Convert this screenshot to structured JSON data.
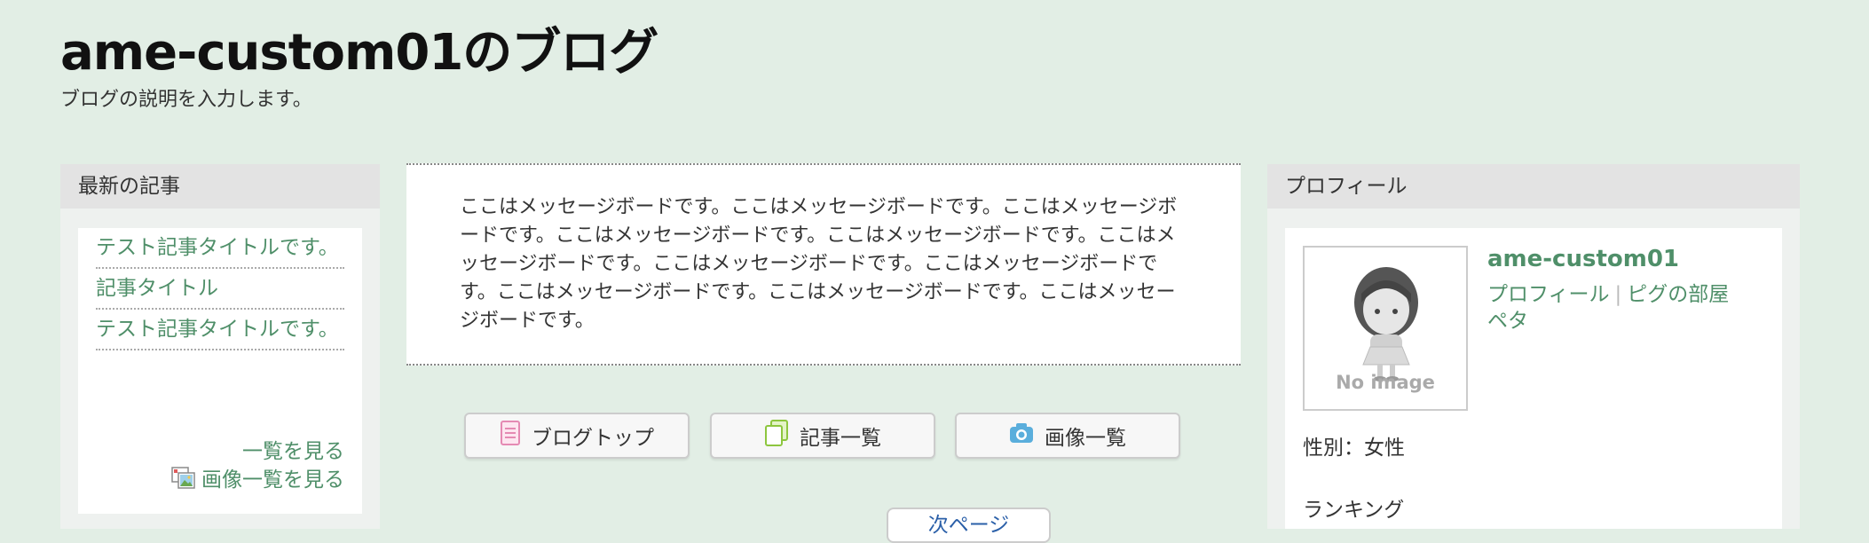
{
  "header": {
    "title": "ame-custom01のブログ",
    "description": "ブログの説明を入力します。"
  },
  "recent": {
    "heading": "最新の記事",
    "items": [
      "テスト記事タイトルです。",
      "記事タイトル",
      "テスト記事タイトルです。"
    ],
    "see_list": "一覧を見る",
    "see_images": "画像一覧を見る"
  },
  "message_board": {
    "text": "ここはメッセージボードです。ここはメッセージボードです。ここはメッセージボードです。ここはメッセージボードです。ここはメッセージボードです。ここはメッセージボードです。ここはメッセージボードです。ここはメッセージボードです。ここはメッセージボードです。ここはメッセージボードです。ここはメッセージボードです。"
  },
  "nav_buttons": {
    "blog_top": "ブログトップ",
    "article_list": "記事一覧",
    "image_list": "画像一覧",
    "next_page": "次ページ"
  },
  "profile": {
    "heading": "プロフィール",
    "name": "ame-custom01",
    "link_profile": "プロフィール",
    "link_room": "ピグの部屋",
    "link_peta": "ペタ",
    "no_image": "No image",
    "gender": "性別：女性",
    "ranking": "ランキング"
  },
  "colors": {
    "background": "#e2eee5",
    "link": "#4f8f69"
  },
  "icons": [
    "document-icon",
    "copy-icon",
    "camera-icon",
    "images-icon",
    "avatar-noimage-icon"
  ]
}
